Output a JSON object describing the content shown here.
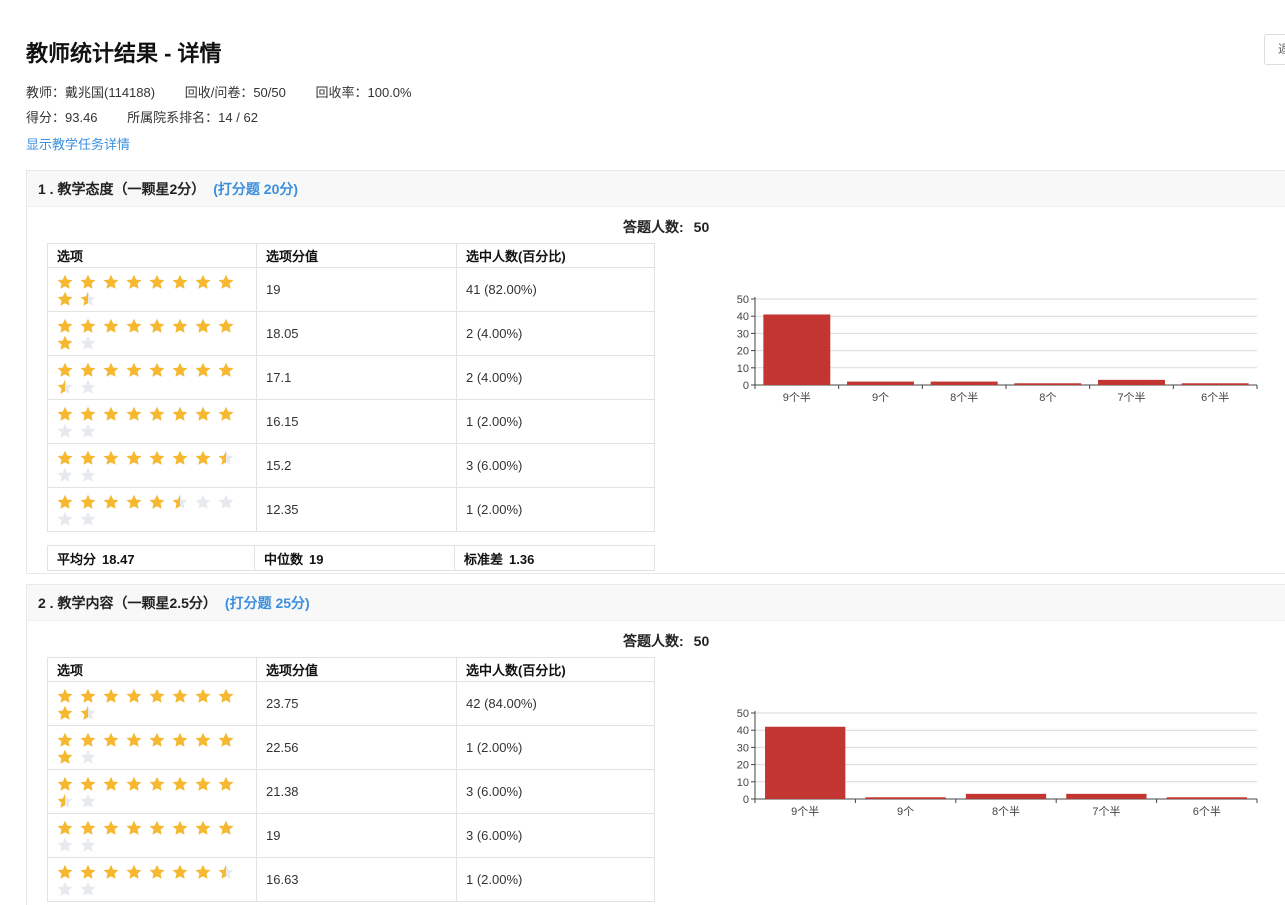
{
  "header": {
    "title": "教师统计结果 - 详情",
    "back_label": "返"
  },
  "meta": {
    "teacher": "教师：戴兆国(114188)",
    "recovered": "回收/问卷：50/50",
    "rate": "回收率：100.0%",
    "score": "得分：93.46",
    "rank": "所属院系排名：14 / 62",
    "detail_link": "显示教学任务详情"
  },
  "colors": {
    "star": "#f5b82e",
    "star_empty": "#e6e9ee",
    "bar": "#c23531",
    "link": "#3b8fdc"
  },
  "table_headers": {
    "option": "选项",
    "score": "选项分值",
    "count": "选中人数(百分比)"
  },
  "questions": [
    {
      "title": "1 . 教学态度（一颗星2分）",
      "qtype": "(打分题 20分)",
      "answer_label": "答题人数:",
      "answer_count": "50",
      "rows": [
        {
          "stars": 9.5,
          "score": "19",
          "count": "41 (82.00%)"
        },
        {
          "stars": 9,
          "score": "18.05",
          "count": "2 (4.00%)"
        },
        {
          "stars": 8.5,
          "score": "17.1",
          "count": "2 (4.00%)"
        },
        {
          "stars": 8,
          "score": "16.15",
          "count": "1 (2.00%)"
        },
        {
          "stars": 7.5,
          "score": "15.2",
          "count": "3 (6.00%)"
        },
        {
          "stars": 5.5,
          "score": "12.35",
          "count": "1 (2.00%)"
        }
      ],
      "summary": {
        "mean_label": "平均分",
        "mean": "18.47",
        "median_label": "中位数",
        "median": "19",
        "std_label": "标准差",
        "std": "1.36"
      }
    },
    {
      "title": "2 . 教学内容（一颗星2.5分）",
      "qtype": "(打分题 25分)",
      "answer_label": "答题人数:",
      "answer_count": "50",
      "rows": [
        {
          "stars": 9.5,
          "score": "23.75",
          "count": "42 (84.00%)"
        },
        {
          "stars": 9,
          "score": "22.56",
          "count": "1 (2.00%)"
        },
        {
          "stars": 8.5,
          "score": "21.38",
          "count": "3 (6.00%)"
        },
        {
          "stars": 8,
          "score": "19",
          "count": "3 (6.00%)"
        },
        {
          "stars": 7.5,
          "score": "16.63",
          "count": "1 (2.00%)"
        }
      ]
    }
  ],
  "chart_data": [
    {
      "type": "bar",
      "categories": [
        "9个半",
        "9个",
        "8个半",
        "8个",
        "7个半",
        "6个半"
      ],
      "values": [
        41,
        2,
        2,
        1,
        3,
        1
      ],
      "ylim": [
        0,
        50
      ],
      "yticks": [
        0,
        10,
        20,
        30,
        40,
        50
      ],
      "grid": true
    },
    {
      "type": "bar",
      "categories": [
        "9个半",
        "9个",
        "8个半",
        "7个半",
        "6个半"
      ],
      "values": [
        42,
        1,
        3,
        3,
        1
      ],
      "ylim": [
        0,
        50
      ],
      "yticks": [
        0,
        10,
        20,
        30,
        40,
        50
      ],
      "grid": true
    }
  ]
}
